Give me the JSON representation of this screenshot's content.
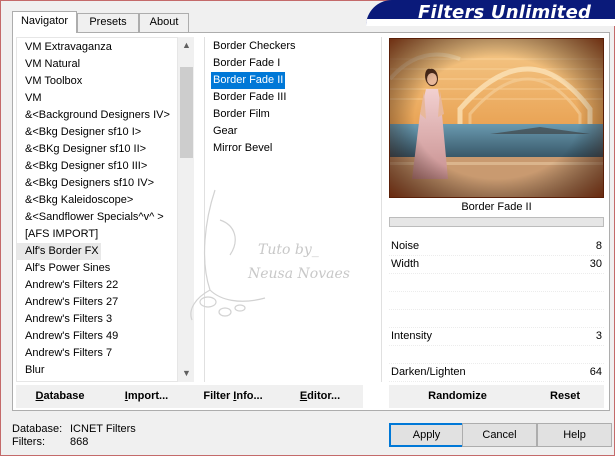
{
  "tabs": [
    {
      "label": "Navigator",
      "active": true
    },
    {
      "label": "Presets",
      "active": false
    },
    {
      "label": "About",
      "active": false
    }
  ],
  "banner": {
    "title": "Filters Unlimited",
    "color": "#0a1a7a"
  },
  "categories": {
    "items": [
      "VM Extravaganza",
      "VM Natural",
      "VM Toolbox",
      "VM",
      "&<Background Designers IV>",
      "&<Bkg Designer sf10 I>",
      "&<BKg Designer sf10 II>",
      "&<Bkg Designer sf10 III>",
      "&<Bkg Designers sf10 IV>",
      "&<Bkg Kaleidoscope>",
      "&<Sandflower Specials^v^ >",
      "[AFS IMPORT]",
      "Alf's Border FX",
      "Alf's Power Sines",
      "Andrew's Filters 22",
      "Andrew's Filters 27",
      "Andrew's Filters 3",
      "Andrew's Filters 49",
      "Andrew's Filters 7",
      "Blur"
    ],
    "hovered": "Alf's Border FX"
  },
  "filters": {
    "items": [
      "Border Checkers",
      "Border Fade I",
      "Border Fade II",
      "Border Fade III",
      "Border Film",
      "Gear",
      "Mirror Bevel"
    ],
    "selected": "Border Fade II"
  },
  "preview": {
    "name": "Border Fade II"
  },
  "params": [
    {
      "label": "Noise",
      "value": "8"
    },
    {
      "label": "Width",
      "value": "30"
    },
    {
      "label": "",
      "value": ""
    },
    {
      "label": "",
      "value": ""
    },
    {
      "label": "",
      "value": ""
    },
    {
      "label": "Intensity",
      "value": "3"
    },
    {
      "label": "",
      "value": ""
    },
    {
      "label": "Darken/Lighten",
      "value": "64"
    }
  ],
  "content_buttons": {
    "database": {
      "pre": "",
      "u": "D",
      "post": "atabase"
    },
    "import": {
      "pre": "",
      "u": "I",
      "post": "mport..."
    },
    "filter_info": {
      "pre": "Filter ",
      "u": "I",
      "post": "nfo..."
    },
    "editor": {
      "pre": "",
      "u": "E",
      "post": "ditor..."
    },
    "randomize": "Randomize",
    "reset": "Reset"
  },
  "footer": {
    "database_label": "Database:",
    "database_value": "ICNET Filters",
    "filters_label": "Filters:",
    "filters_value": "868"
  },
  "dialog_buttons": {
    "apply": "Apply",
    "cancel": "Cancel",
    "help": "Help"
  },
  "watermark": {
    "line1": "Tuto by_",
    "line2": "Neusa Novaes"
  }
}
